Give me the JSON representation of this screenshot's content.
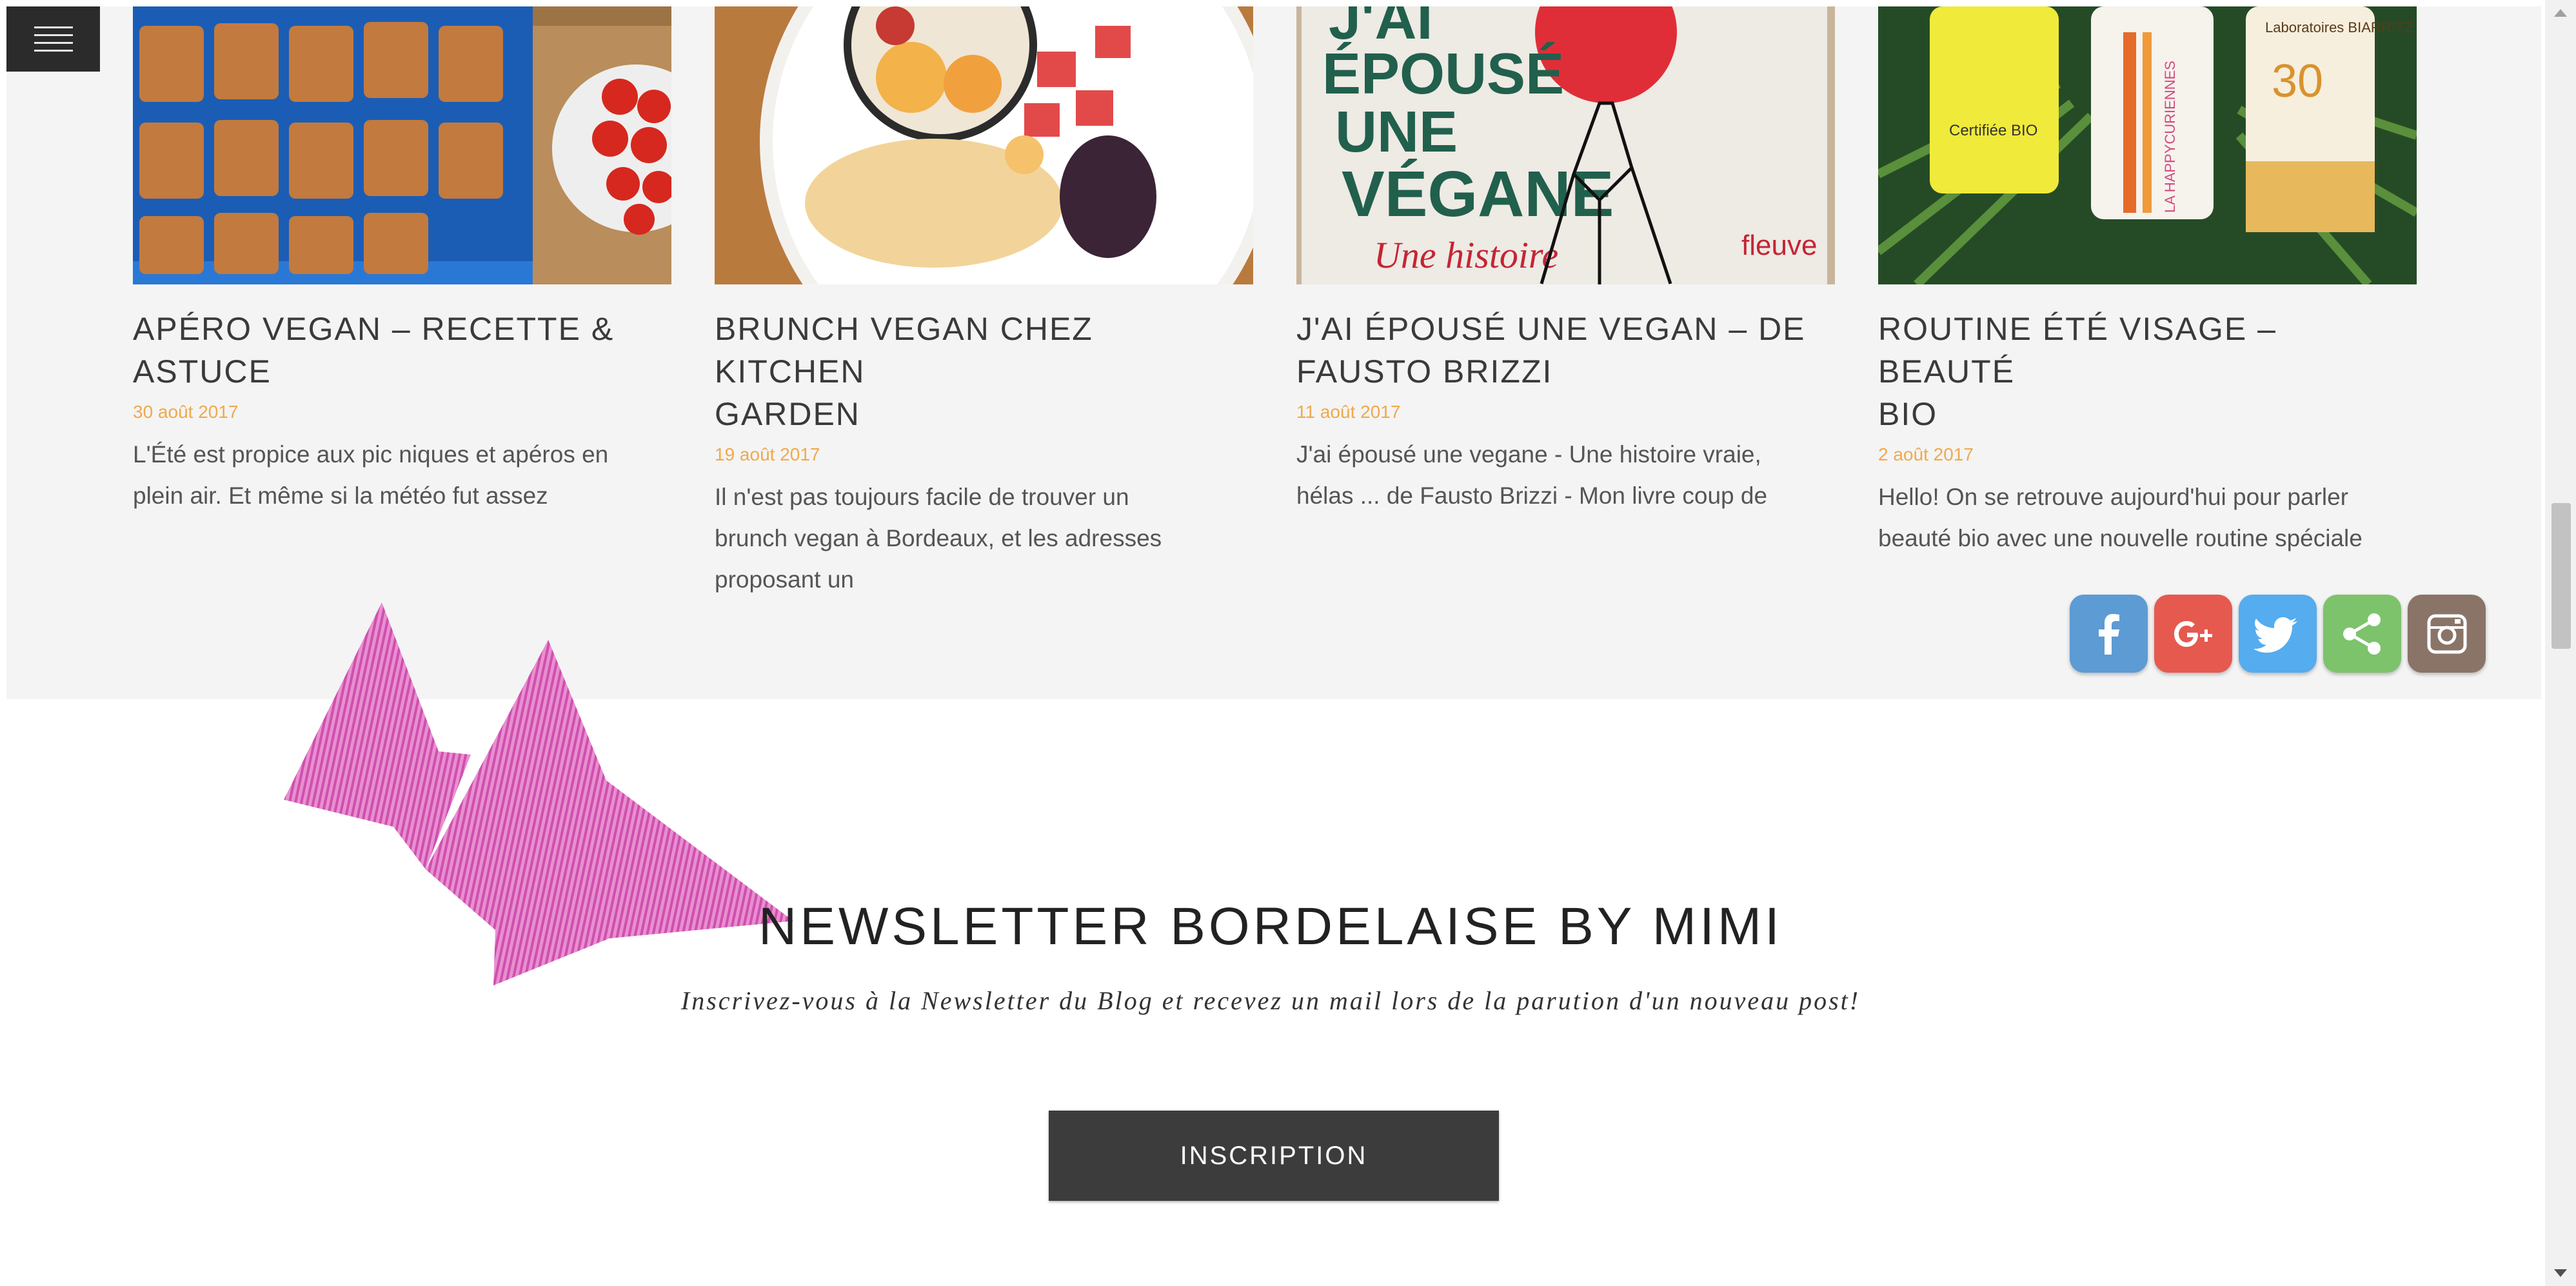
{
  "posts": [
    {
      "title": "APÉRO VEGAN – RECETTE & ASTUCE",
      "title_lines": [
        "APÉRO VEGAN – RECETTE &",
        "ASTUCE"
      ],
      "date": "30 août 2017",
      "excerpt_lines": [
        "L'Été est propice aux pic niques et apéros en",
        "plein air. Et même si la météo fut assez"
      ]
    },
    {
      "title": "BRUNCH VEGAN CHEZ KITCHEN GARDEN",
      "title_lines": [
        "BRUNCH VEGAN CHEZ KITCHEN",
        "GARDEN"
      ],
      "date": "19 août 2017",
      "excerpt_lines": [
        "Il n'est pas toujours facile de trouver un",
        "brunch vegan à Bordeaux, et les adresses",
        "proposant un"
      ]
    },
    {
      "title": "J'AI ÉPOUSÉ UNE VEGAN – DE FAUSTO BRIZZI",
      "title_lines": [
        "J'AI ÉPOUSÉ UNE VEGAN – DE",
        "FAUSTO BRIZZI"
      ],
      "date": "11 août 2017",
      "excerpt_lines": [
        "J'ai épousé une vegane - Une histoire vraie,",
        "hélas ... de Fausto Brizzi - Mon livre coup de"
      ],
      "book_cover": {
        "line1": "J'AI",
        "line2": "ÉPOUSÉ",
        "line3": "UNE",
        "line4": "VÉGANE",
        "tagline": "Une histoire",
        "publisher": "fleuve"
      }
    },
    {
      "title": "ROUTINE ÉTÉ VISAGE – BEAUTÉ BIO",
      "title_lines": [
        "ROUTINE ÉTÉ VISAGE – BEAUTÉ",
        "BIO"
      ],
      "date": "2 août 2017",
      "excerpt_lines": [
        "Hello! On se retrouve aujourd'hui pour parler",
        "beauté bio avec une nouvelle routine spéciale"
      ],
      "product_labels": {
        "tube1": "Certifiée BIO",
        "tube2": "LA HAPPYCURIENNES",
        "tube3_brand": "Laboratoires BIARRITZ",
        "tube3_spf": "30"
      }
    }
  ],
  "social": [
    {
      "icon": "facebook-icon",
      "color": "#5d9bd5"
    },
    {
      "icon": "google-plus-icon",
      "color": "#e6594f"
    },
    {
      "icon": "twitter-icon",
      "color": "#55acee"
    },
    {
      "icon": "share-icon",
      "color": "#7dc36b"
    },
    {
      "icon": "instagram-icon",
      "color": "#8a7468"
    }
  ],
  "newsletter": {
    "title": "NEWSLETTER BORDELAISE BY MIMI",
    "subtitle": "Inscrivez-vous à la Newsletter du Blog et recevez un mail lors de la parution d'un nouveau post!",
    "button_label": "INSCRIPTION"
  },
  "colors": {
    "date": "#f0a94a",
    "arrow": "#d257b3",
    "button": "#3c3c3c",
    "menu": "#2b2b2b",
    "band": "#f4f4f4"
  }
}
